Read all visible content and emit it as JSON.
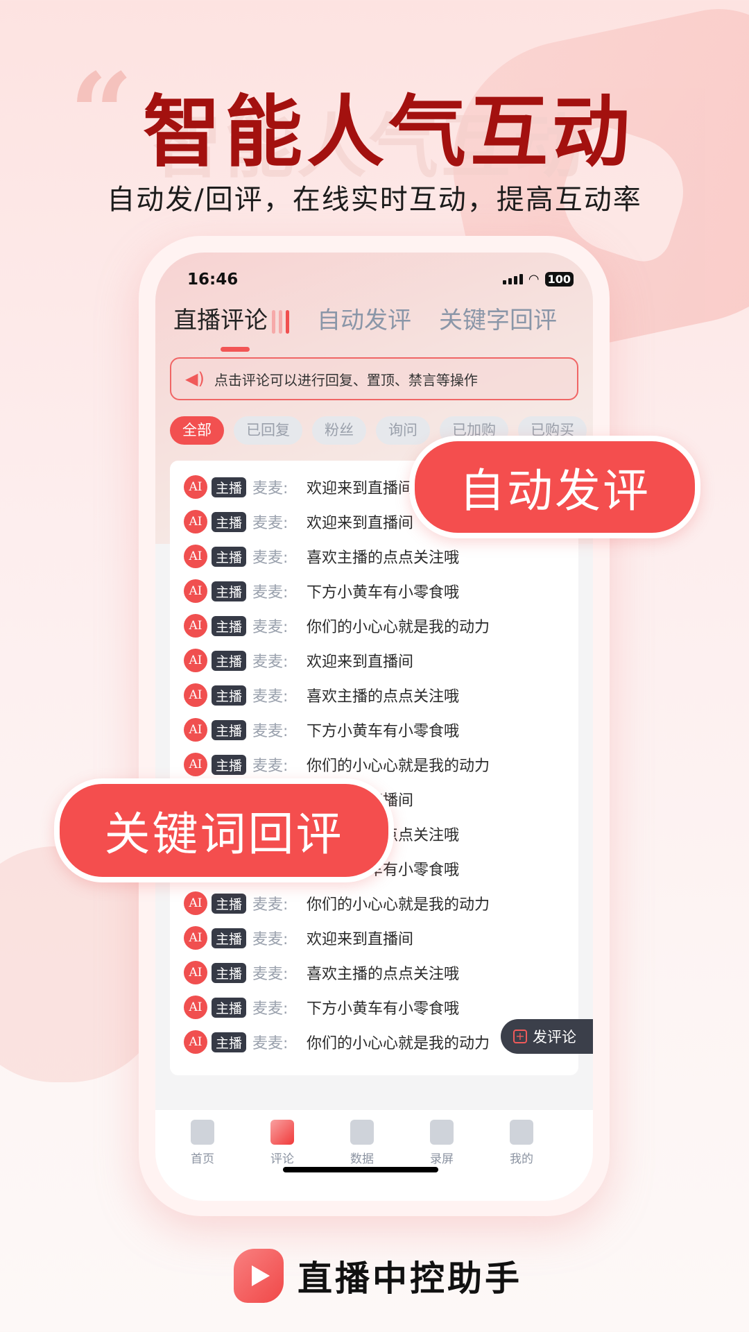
{
  "hero": {
    "title": "智能人气互动",
    "subtitle": "自动发/回评，在线实时互动，提高互动率"
  },
  "status_bar": {
    "time": "16:46",
    "battery": "100"
  },
  "tabs": [
    {
      "label": "直播评论",
      "active": true
    },
    {
      "label": "自动发评"
    },
    {
      "label": "关键字回评"
    }
  ],
  "notice": {
    "icon": "speaker-icon",
    "text": "点击评论可以进行回复、置顶、禁言等操作"
  },
  "filters": [
    "全部",
    "已回复",
    "粉丝",
    "询问",
    "已加购",
    "已购买"
  ],
  "comment_badge": {
    "ai": "AI",
    "role": "主播",
    "name": "麦麦:"
  },
  "comments": [
    "欢迎来到直播间",
    "欢迎来到直播间",
    "喜欢主播的点点关注哦",
    "下方小黄车有小零食哦",
    "你们的小心心就是我的动力",
    "欢迎来到直播间",
    "喜欢主播的点点关注哦",
    "下方小黄车有小零食哦",
    "你们的小心心就是我的动力",
    "欢迎来到直播间",
    "喜欢主播的点点关注哦",
    "下方小黄车有小零食哦",
    "你们的小心心就是我的动力",
    "欢迎来到直播间",
    "喜欢主播的点点关注哦",
    "下方小黄车有小零食哦",
    "你们的小心心就是我的动力"
  ],
  "fab": {
    "label": "发评论"
  },
  "nav": [
    {
      "label": "首页",
      "icon": "home-icon"
    },
    {
      "label": "评论",
      "icon": "comment-icon",
      "active": true
    },
    {
      "label": "数据",
      "icon": "data-icon"
    },
    {
      "label": "录屏",
      "icon": "screen-record-icon"
    },
    {
      "label": "我的",
      "icon": "profile-icon"
    }
  ],
  "callouts": {
    "auto_comment": "自动发评",
    "keyword_reply": "关键词回评"
  },
  "brand": {
    "name": "直播中控助手"
  },
  "colors": {
    "accent": "#f44e4e",
    "title": "#a3110f"
  }
}
